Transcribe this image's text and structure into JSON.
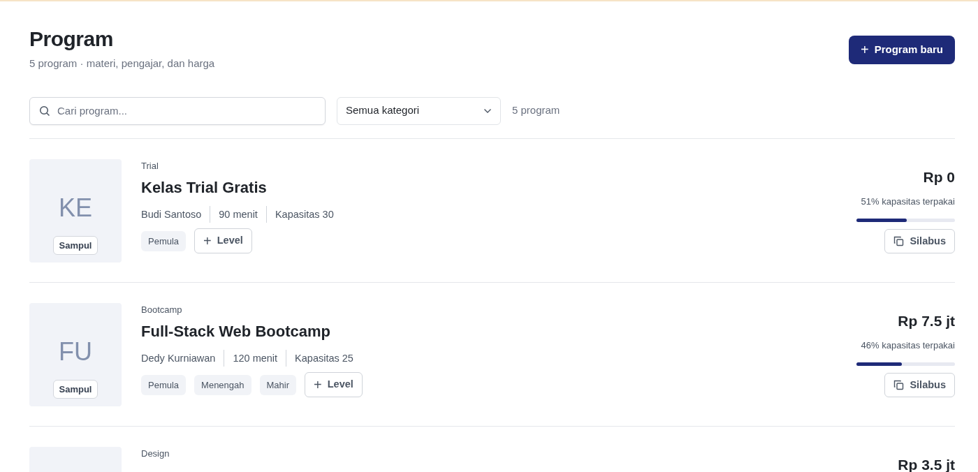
{
  "header": {
    "title": "Program",
    "subtitle": "5 program · materi, pengajar, dan harga",
    "new_button": {
      "icon": "+",
      "label": "Program baru"
    }
  },
  "filters": {
    "search": {
      "placeholder": "Cari program..."
    },
    "category": {
      "value": "Semua kategori"
    },
    "count": "5 program"
  },
  "programs": [
    {
      "initials": "KE",
      "cover_label": "Sampul",
      "category": "Trial",
      "title": "Kelas Trial Gratis",
      "meta": [
        "Budi Santoso",
        "90 menit",
        "Kapasitas 30"
      ],
      "levels": [
        "Pemula"
      ],
      "level_button": {
        "icon": "+",
        "label": "Level"
      },
      "price": "Rp 0",
      "usage": "51% kapasitas terpakai",
      "level": 0.51,
      "syllabus_button": "Silabus"
    },
    {
      "initials": "FU",
      "cover_label": "Sampul",
      "category": "Bootcamp",
      "title": "Full-Stack Web Bootcamp",
      "meta": [
        "Dedy Kurniawan",
        "120 menit",
        "Kapasitas 25"
      ],
      "levels": [
        "Pemula",
        "Menengah",
        "Mahir"
      ],
      "level_button": {
        "icon": "+",
        "label": "Level"
      },
      "price": "Rp 7.5 jt",
      "usage": "46% kapasitas terpakai",
      "level": 0.46,
      "syllabus_button": "Silabus"
    },
    {
      "category": "Design",
      "price": "Rp 3.5 jt"
    }
  ]
}
